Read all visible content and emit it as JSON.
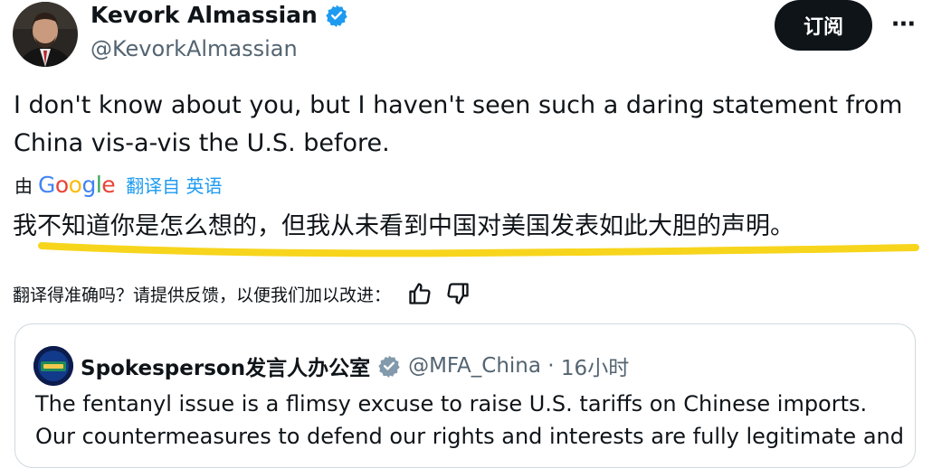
{
  "author": {
    "name": "Kevork Almassian",
    "handle": "@KevorkAlmassian"
  },
  "actions": {
    "subscribe_label": "订阅",
    "more_label": "···"
  },
  "tweet": {
    "text": "I don't know about you, but I haven't seen such a daring statement from China vis-a-vis the U.S. before."
  },
  "translation": {
    "prefix": "由",
    "provider": "Google",
    "from_label": "翻译自 英语",
    "text": "我不知道你是怎么想的，但我从未看到中国对美国发表如此大胆的声明。",
    "feedback_prompt": "翻译得准确吗？请提供反馈，以便我们加以改进："
  },
  "quoted": {
    "name": "Spokesperson发言人办公室",
    "handle": "@MFA_China",
    "separator": " · ",
    "time": "16小时",
    "text": "The fentanyl issue is a flimsy excuse to raise U.S. tariffs on Chinese imports. Our countermeasures to defend our rights and interests are fully legitimate and"
  },
  "colors": {
    "accent": "#1d9bf0",
    "highlight": "#f7d51d",
    "gov_badge": "#829aab",
    "text": "#0f1419",
    "muted": "#536471"
  },
  "icons": {
    "verified": "verified-badge-icon",
    "gov": "government-badge-icon",
    "thumbs_up": "thumbs-up-icon",
    "thumbs_down": "thumbs-down-icon",
    "more": "more-icon"
  }
}
